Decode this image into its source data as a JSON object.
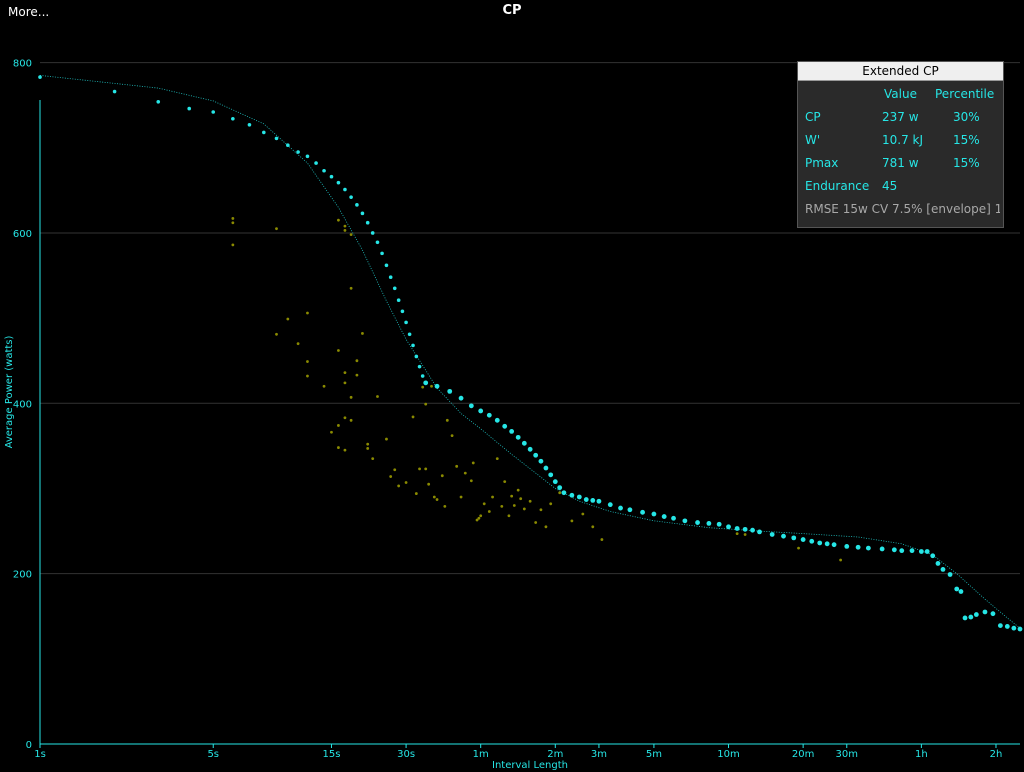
{
  "header": {
    "more_label": "More...",
    "title": "CP"
  },
  "panel": {
    "title": "Extended CP",
    "col_value": "Value",
    "col_percentile": "Percentile",
    "rows": [
      {
        "label": "CP",
        "value": "237 w",
        "percentile": "30%"
      },
      {
        "label": "W'",
        "value": "10.7 kJ",
        "percentile": "15%"
      },
      {
        "label": "Pmax",
        "value": "781 w",
        "percentile": "15%"
      },
      {
        "label": "Endurance",
        "value": "45",
        "percentile": ""
      }
    ],
    "rmse": "RMSE 15w CV 7.5% [envelope] 1"
  },
  "chart_data": {
    "type": "scatter",
    "xlabel": "Interval Length",
    "ylabel": "Average Power (watts)",
    "x_scale": "log",
    "x_unit": "seconds",
    "xlim": [
      1,
      9000
    ],
    "ylim": [
      0,
      850
    ],
    "yticks": [
      0,
      200,
      400,
      600,
      800
    ],
    "xticks": [
      {
        "label": "1s",
        "x": 1
      },
      {
        "label": "5s",
        "x": 5
      },
      {
        "label": "15s",
        "x": 15
      },
      {
        "label": "30s",
        "x": 30
      },
      {
        "label": "1m",
        "x": 60
      },
      {
        "label": "2m",
        "x": 120
      },
      {
        "label": "3m",
        "x": 180
      },
      {
        "label": "5m",
        "x": 300
      },
      {
        "label": "10m",
        "x": 600
      },
      {
        "label": "20m",
        "x": 1200
      },
      {
        "label": "30m",
        "x": 1800
      },
      {
        "label": "1h",
        "x": 3600
      },
      {
        "label": "2h",
        "x": 7200
      }
    ],
    "grid": true,
    "colors": {
      "curve": "#26e6e6",
      "model": "#26e6e6",
      "efforts": "#8a8a00",
      "axis": "#26e6e6"
    },
    "series": [
      {
        "type": "scatter",
        "points": [
          [
            1,
            783
          ],
          [
            2,
            766
          ],
          [
            3,
            754
          ],
          [
            4,
            746
          ],
          [
            5,
            742
          ],
          [
            6,
            734
          ],
          [
            7,
            727
          ],
          [
            8,
            718
          ],
          [
            9,
            711
          ],
          [
            10,
            703
          ],
          [
            11,
            695
          ],
          [
            12,
            690
          ],
          [
            13,
            682
          ],
          [
            14,
            673
          ],
          [
            15,
            666
          ],
          [
            16,
            659
          ],
          [
            17,
            651
          ],
          [
            18,
            642
          ],
          [
            19,
            633
          ],
          [
            20,
            623
          ],
          [
            21,
            612
          ],
          [
            22,
            600
          ],
          [
            23,
            589
          ],
          [
            24,
            576
          ],
          [
            25,
            562
          ],
          [
            26,
            548
          ],
          [
            27,
            535
          ],
          [
            28,
            521
          ],
          [
            29,
            508
          ],
          [
            30,
            495
          ],
          [
            31,
            481
          ],
          [
            32,
            468
          ],
          [
            33,
            455
          ],
          [
            34,
            443
          ],
          [
            35,
            432
          ],
          [
            36,
            424
          ],
          [
            40,
            420
          ],
          [
            45,
            414
          ],
          [
            50,
            406
          ],
          [
            55,
            397
          ],
          [
            60,
            391
          ],
          [
            65,
            386
          ],
          [
            70,
            380
          ],
          [
            75,
            373
          ],
          [
            80,
            367
          ],
          [
            85,
            360
          ],
          [
            90,
            353
          ],
          [
            95,
            346
          ],
          [
            100,
            339
          ],
          [
            105,
            332
          ],
          [
            110,
            324
          ],
          [
            115,
            316
          ],
          [
            120,
            308
          ],
          [
            125,
            301
          ],
          [
            130,
            295
          ],
          [
            140,
            292
          ],
          [
            150,
            290
          ],
          [
            160,
            287
          ],
          [
            170,
            286
          ],
          [
            180,
            285
          ],
          [
            200,
            281
          ],
          [
            220,
            277
          ],
          [
            240,
            275
          ],
          [
            270,
            272
          ],
          [
            300,
            270
          ],
          [
            330,
            267
          ],
          [
            360,
            265
          ],
          [
            400,
            262
          ],
          [
            450,
            260
          ],
          [
            500,
            259
          ],
          [
            550,
            258
          ],
          [
            600,
            255
          ],
          [
            650,
            253
          ],
          [
            700,
            252
          ],
          [
            750,
            251
          ],
          [
            800,
            249
          ],
          [
            900,
            246
          ],
          [
            1000,
            244
          ],
          [
            1100,
            242
          ],
          [
            1200,
            240
          ],
          [
            1300,
            238
          ],
          [
            1400,
            236
          ],
          [
            1500,
            235
          ],
          [
            1600,
            234
          ],
          [
            1800,
            232
          ],
          [
            2000,
            231
          ],
          [
            2200,
            230
          ],
          [
            2500,
            229
          ],
          [
            2800,
            228
          ],
          [
            3000,
            227
          ],
          [
            3300,
            227
          ],
          [
            3600,
            226
          ],
          [
            3800,
            226
          ],
          [
            4000,
            221
          ],
          [
            4200,
            212
          ],
          [
            4400,
            205
          ],
          [
            4700,
            199
          ],
          [
            5000,
            182
          ],
          [
            5200,
            179
          ],
          [
            5400,
            148
          ],
          [
            5700,
            149
          ],
          [
            6000,
            152
          ],
          [
            6500,
            155
          ],
          [
            7000,
            153
          ],
          [
            7500,
            139
          ],
          [
            8000,
            138
          ],
          [
            8500,
            136
          ],
          [
            9000,
            135
          ]
        ]
      },
      {
        "type": "scatter-secondary",
        "points": [
          [
            6,
            617
          ],
          [
            6,
            612
          ],
          [
            6,
            586
          ],
          [
            9,
            605
          ],
          [
            9,
            481
          ],
          [
            10,
            499
          ],
          [
            11,
            470
          ],
          [
            12,
            506
          ],
          [
            12,
            449
          ],
          [
            12,
            432
          ],
          [
            14,
            420
          ],
          [
            15,
            366
          ],
          [
            16,
            615
          ],
          [
            16,
            374
          ],
          [
            16,
            462
          ],
          [
            16,
            348
          ],
          [
            17,
            608
          ],
          [
            17,
            603
          ],
          [
            17,
            383
          ],
          [
            17,
            345
          ],
          [
            17,
            436
          ],
          [
            17,
            424
          ],
          [
            18,
            598
          ],
          [
            18,
            535
          ],
          [
            18,
            407
          ],
          [
            18,
            380
          ],
          [
            19,
            450
          ],
          [
            19,
            433
          ],
          [
            20,
            482
          ],
          [
            21,
            352
          ],
          [
            21,
            347
          ],
          [
            22,
            335
          ],
          [
            23,
            408
          ],
          [
            25,
            358
          ],
          [
            26,
            314
          ],
          [
            27,
            322
          ],
          [
            28,
            303
          ],
          [
            30,
            307
          ],
          [
            32,
            384
          ],
          [
            33,
            294
          ],
          [
            34,
            323
          ],
          [
            35,
            419
          ],
          [
            36,
            399
          ],
          [
            36,
            323
          ],
          [
            37,
            305
          ],
          [
            38,
            420
          ],
          [
            39,
            290
          ],
          [
            40,
            287
          ],
          [
            42,
            315
          ],
          [
            43,
            279
          ],
          [
            44,
            380
          ],
          [
            46,
            362
          ],
          [
            48,
            326
          ],
          [
            50,
            290
          ],
          [
            52,
            318
          ],
          [
            55,
            309
          ],
          [
            56,
            330
          ],
          [
            58,
            263
          ],
          [
            59,
            265
          ],
          [
            60,
            268
          ],
          [
            62,
            282
          ],
          [
            65,
            273
          ],
          [
            67,
            290
          ],
          [
            70,
            335
          ],
          [
            73,
            279
          ],
          [
            75,
            308
          ],
          [
            78,
            268
          ],
          [
            80,
            291
          ],
          [
            82,
            280
          ],
          [
            85,
            298
          ],
          [
            87,
            288
          ],
          [
            90,
            276
          ],
          [
            95,
            285
          ],
          [
            100,
            260
          ],
          [
            105,
            275
          ],
          [
            110,
            255
          ],
          [
            115,
            282
          ],
          [
            125,
            295
          ],
          [
            140,
            262
          ],
          [
            155,
            270
          ],
          [
            170,
            255
          ],
          [
            185,
            240
          ],
          [
            650,
            247
          ],
          [
            700,
            246
          ],
          [
            1150,
            230
          ],
          [
            1700,
            216
          ]
        ]
      },
      {
        "type": "model",
        "points": [
          [
            1,
            785
          ],
          [
            3,
            770
          ],
          [
            5,
            755
          ],
          [
            8,
            728
          ],
          [
            12,
            682
          ],
          [
            16,
            630
          ],
          [
            20,
            580
          ],
          [
            25,
            520
          ],
          [
            30,
            475
          ],
          [
            40,
            418
          ],
          [
            50,
            388
          ],
          [
            60,
            370
          ],
          [
            80,
            340
          ],
          [
            100,
            318
          ],
          [
            120,
            300
          ],
          [
            150,
            285
          ],
          [
            200,
            273
          ],
          [
            300,
            262
          ],
          [
            500,
            254
          ],
          [
            800,
            250
          ],
          [
            1200,
            247
          ],
          [
            2000,
            243
          ],
          [
            3000,
            235
          ],
          [
            4000,
            222
          ],
          [
            5000,
            200
          ],
          [
            6500,
            170
          ],
          [
            8000,
            148
          ],
          [
            9000,
            136
          ]
        ]
      }
    ]
  }
}
